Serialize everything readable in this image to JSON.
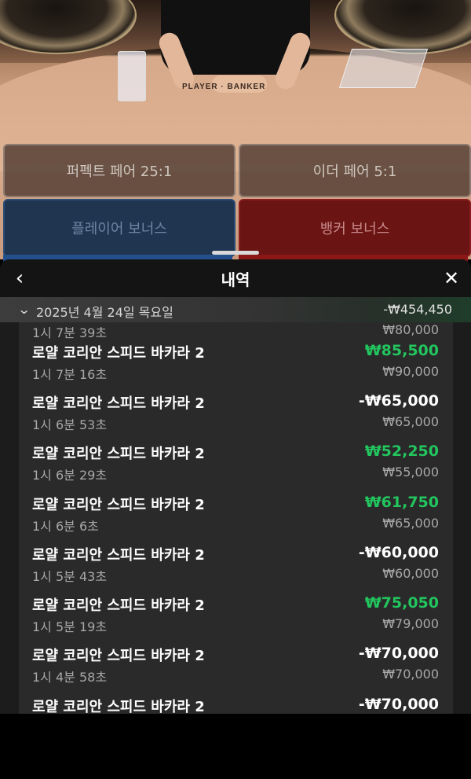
{
  "bets": {
    "perfect_pair": "퍼펙트 페어 25:1",
    "either_pair": "이더 페어 5:1",
    "player_bonus": "플레이어 보너스",
    "banker_bonus": "뱅커 보너스"
  },
  "table_text": "PLAYER · BANKER",
  "header": {
    "back_icon": "chevron-left-icon",
    "title": "내역",
    "close_icon": "close-icon"
  },
  "date_group": {
    "date": "2025년 4월 24일 목요일",
    "total": "-₩454,450"
  },
  "partial_top": {
    "time": "1시 7분 39초",
    "bet": "₩80,000"
  },
  "rows": [
    {
      "game": "로얄 코리안 스피드 바카라 2",
      "time": "1시 7분 16초",
      "amount": "₩85,500",
      "bet": "₩90,000",
      "win": true
    },
    {
      "game": "로얄 코리안 스피드 바카라 2",
      "time": "1시 6분 53초",
      "amount": "-₩65,000",
      "bet": "₩65,000",
      "win": false
    },
    {
      "game": "로얄 코리안 스피드 바카라 2",
      "time": "1시 6분 29초",
      "amount": "₩52,250",
      "bet": "₩55,000",
      "win": true
    },
    {
      "game": "로얄 코리안 스피드 바카라 2",
      "time": "1시 6분 6초",
      "amount": "₩61,750",
      "bet": "₩65,000",
      "win": true
    },
    {
      "game": "로얄 코리안 스피드 바카라 2",
      "time": "1시 5분 43초",
      "amount": "-₩60,000",
      "bet": "₩60,000",
      "win": false
    },
    {
      "game": "로얄 코리안 스피드 바카라 2",
      "time": "1시 5분 19초",
      "amount": "₩75,050",
      "bet": "₩79,000",
      "win": true
    },
    {
      "game": "로얄 코리안 스피드 바카라 2",
      "time": "1시 4분 58초",
      "amount": "-₩70,000",
      "bet": "₩70,000",
      "win": false
    },
    {
      "game": "로얄 코리안 스피드 바카라 2",
      "time": "",
      "amount": "-₩70,000",
      "bet": "",
      "win": false
    }
  ],
  "colors": {
    "win": "#22c55e",
    "loss": "#ffffff"
  }
}
